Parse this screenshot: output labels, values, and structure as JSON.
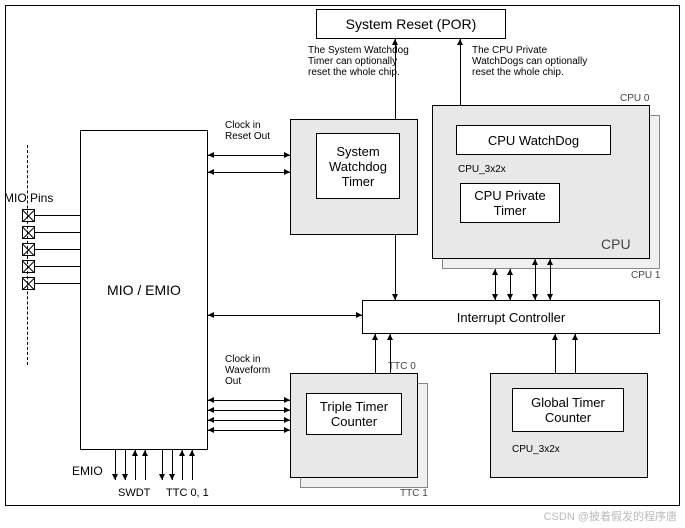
{
  "blocks": {
    "system_reset": "System Reset (POR)",
    "mio_emio": "MIO / EMIO",
    "swt_outer_label": "",
    "swt": "System\nWatchdog\nTimer",
    "cpu_wd": "CPU WatchDog",
    "cpu_priv_timer": "CPU Private\nTimer",
    "cpu_label": "CPU",
    "interrupt": "Interrupt Controller",
    "ttc": "Triple Timer\nCounter",
    "gtc": "Global Timer\nCounter"
  },
  "annotations": {
    "note_swt": "The System Watchdog\nTimer can optionally\nreset the whole chip.",
    "note_cpu": "The CPU Private\nWatchDogs can optionally\nreset the whole chip.",
    "clock_reset": "Clock in\nReset Out",
    "clock_wave": "Clock in\nWaveform\nOut",
    "mio_pins": "MIO Pins",
    "emio": "EMIO",
    "swdt": "SWDT",
    "ttc01": "TTC 0, 1",
    "cpu_3x2x_a": "CPU_3x2x",
    "cpu_3x2x_b": "CPU_3x2x",
    "ttc0_tag": "TTC 0",
    "ttc1_tag": "TTC 1",
    "cpu0_tag": "CPU 0",
    "cpu1_tag": "CPU 1"
  },
  "watermark": "CSDN @披着假发的程序唐"
}
